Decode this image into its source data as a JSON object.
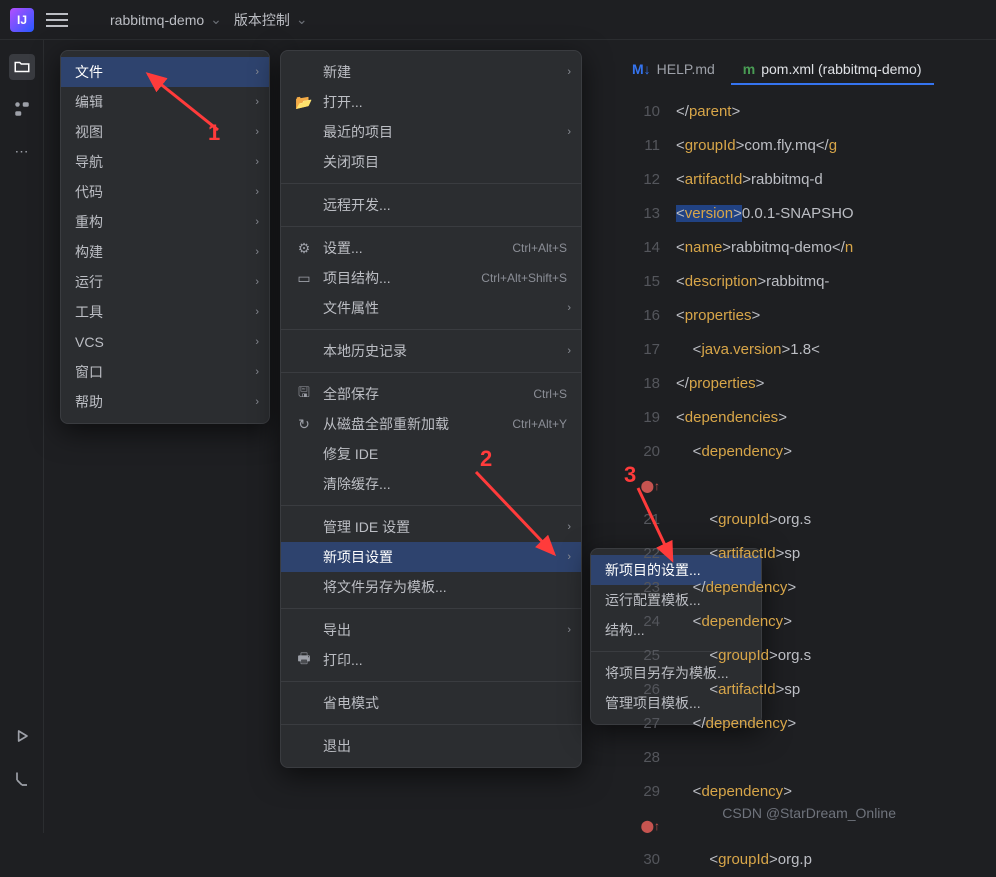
{
  "topbar": {
    "project": "rabbitmq-demo",
    "vcs": "版本控制"
  },
  "menu1": [
    {
      "k": "file",
      "label": "文件",
      "arrow": true,
      "sel": true
    },
    {
      "k": "edit",
      "label": "编辑",
      "arrow": true
    },
    {
      "k": "view",
      "label": "视图",
      "arrow": true
    },
    {
      "k": "nav",
      "label": "导航",
      "arrow": true
    },
    {
      "k": "code",
      "label": "代码",
      "arrow": true
    },
    {
      "k": "refactor",
      "label": "重构",
      "arrow": true
    },
    {
      "k": "build",
      "label": "构建",
      "arrow": true
    },
    {
      "k": "run",
      "label": "运行",
      "arrow": true
    },
    {
      "k": "tools",
      "label": "工具",
      "arrow": true
    },
    {
      "k": "vcs",
      "label": "VCS",
      "arrow": true
    },
    {
      "k": "window",
      "label": "窗口",
      "arrow": true
    },
    {
      "k": "help",
      "label": "帮助",
      "arrow": true
    }
  ],
  "menu2_groups": [
    [
      {
        "label": "新建",
        "noic": true,
        "arrow": true
      },
      {
        "label": "打开...",
        "icon": "📂"
      },
      {
        "label": "最近的项目",
        "noic": true,
        "arrow": true
      },
      {
        "label": "关闭项目",
        "noic": true
      }
    ],
    [
      {
        "label": "远程开发...",
        "noic": true
      }
    ],
    [
      {
        "label": "设置...",
        "icon": "⚙",
        "sc": "Ctrl+Alt+S"
      },
      {
        "label": "项目结构...",
        "icon": "▭",
        "sc": "Ctrl+Alt+Shift+S"
      },
      {
        "label": "文件属性",
        "noic": true,
        "arrow": true
      }
    ],
    [
      {
        "label": "本地历史记录",
        "noic": true,
        "arrow": true
      }
    ],
    [
      {
        "label": "全部保存",
        "icon": "🖫",
        "sc": "Ctrl+S"
      },
      {
        "label": "从磁盘全部重新加载",
        "icon": "↻",
        "sc": "Ctrl+Alt+Y"
      },
      {
        "label": "修复 IDE",
        "noic": true
      },
      {
        "label": "清除缓存...",
        "noic": true
      }
    ],
    [
      {
        "label": "管理 IDE 设置",
        "noic": true,
        "arrow": true
      },
      {
        "label": "新项目设置",
        "noic": true,
        "arrow": true,
        "sel": true
      },
      {
        "label": "将文件另存为模板...",
        "noic": true
      }
    ],
    [
      {
        "label": "导出",
        "noic": true,
        "arrow": true
      },
      {
        "label": "打印...",
        "icon": "🖶"
      }
    ],
    [
      {
        "label": "省电模式",
        "noic": true
      }
    ],
    [
      {
        "label": "退出",
        "noic": true
      }
    ]
  ],
  "menu3": [
    {
      "label": "新项目的设置...",
      "sel": true
    },
    {
      "label": "运行配置模板..."
    },
    {
      "label": "结构..."
    },
    {
      "sep": true
    },
    {
      "label": "将项目另存为模板..."
    },
    {
      "label": "管理项目模板..."
    }
  ],
  "tabs": [
    {
      "label": "HELP.md",
      "icon": "M↓",
      "act": false
    },
    {
      "label": "pom.xml (rabbitmq-demo)",
      "icon": "m",
      "act": true
    }
  ],
  "code_lines": [
    {
      "n": "10",
      "html": "&lt;/<span class='t-tag'>parent</span>&gt;"
    },
    {
      "n": "11",
      "html": "&lt;<span class='t-tag'>groupId</span>&gt;com.fly.mq&lt;/<span class='t-tag'>g</span>"
    },
    {
      "n": "12",
      "html": "&lt;<span class='t-tag'>artifactId</span>&gt;rabbitmq-d"
    },
    {
      "n": "13",
      "html": "<span class='t-hl'>&lt;<span class='t-tag'>version</span>&gt;</span>0.0.1-SNAPSHO"
    },
    {
      "n": "14",
      "html": "&lt;<span class='t-tag'>name</span>&gt;rabbitmq-demo&lt;/<span class='t-tag'>n</span>"
    },
    {
      "n": "15",
      "html": "&lt;<span class='t-tag'>description</span>&gt;rabbitmq-"
    },
    {
      "n": "16",
      "html": "&lt;<span class='t-tag'>properties</span>&gt;"
    },
    {
      "n": "17",
      "html": "    &lt;<span class='t-tag'>java.version</span>&gt;1.8&lt;"
    },
    {
      "n": "18",
      "html": "&lt;/<span class='t-tag'>properties</span>&gt;"
    },
    {
      "n": "19",
      "html": "&lt;<span class='t-tag'>dependencies</span>&gt;"
    },
    {
      "n": "20",
      "html": "    &lt;<span class='t-tag'>dependency</span>&gt;",
      "gi": "⬤↑"
    },
    {
      "n": "21",
      "html": "        &lt;<span class='t-tag'>groupId</span>&gt;org.s"
    },
    {
      "n": "22",
      "html": "        &lt;<span class='t-tag'>artifactId</span>&gt;sp"
    },
    {
      "n": "23",
      "html": "    &lt;/<span class='t-tag'>dependency</span>&gt;"
    },
    {
      "n": "24",
      "html": "    &lt;<span class='t-tag'>dependency</span>&gt;"
    },
    {
      "n": "25",
      "html": "        &lt;<span class='t-tag'>groupId</span>&gt;org.s"
    },
    {
      "n": "26",
      "html": "        &lt;<span class='t-tag'>artifactId</span>&gt;sp"
    },
    {
      "n": "27",
      "html": "    &lt;/<span class='t-tag'>dependency</span>&gt;"
    },
    {
      "n": "28",
      "html": ""
    },
    {
      "n": "29",
      "html": "    &lt;<span class='t-tag'>dependency</span>&gt;",
      "gi": "⬤↑"
    },
    {
      "n": "30",
      "html": "        &lt;<span class='t-tag'>groupId</span>&gt;org.p"
    }
  ],
  "ann": {
    "a1": "1",
    "a2": "2",
    "a3": "3"
  },
  "watermark": "CSDN @StarDream_Online"
}
